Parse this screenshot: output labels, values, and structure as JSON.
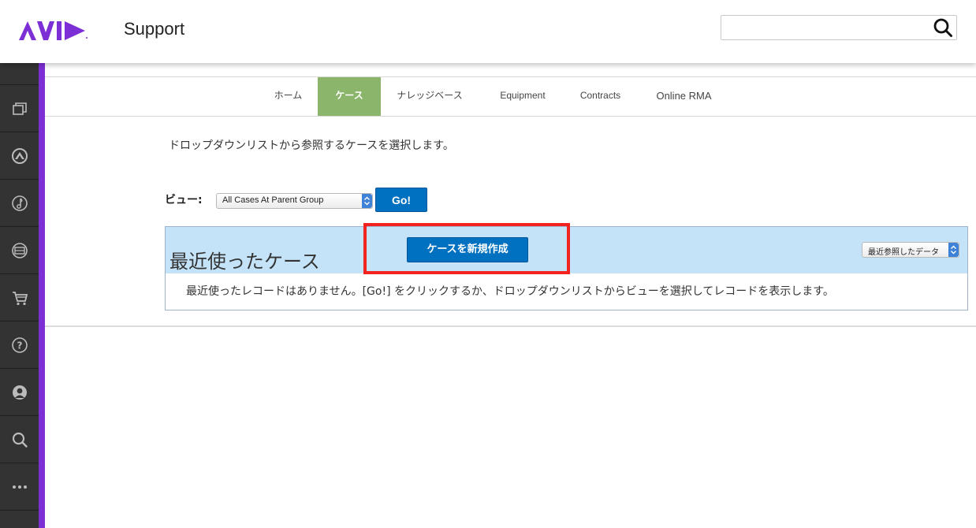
{
  "header": {
    "brand_title": "Support",
    "search": {
      "value": "",
      "placeholder": ""
    }
  },
  "sidebar": {
    "items": [
      {
        "icon": "windows-icon"
      },
      {
        "icon": "avid-link-icon"
      },
      {
        "icon": "music-note-icon"
      },
      {
        "icon": "film-reel-icon"
      },
      {
        "icon": "cart-icon"
      },
      {
        "icon": "help-icon"
      },
      {
        "icon": "user-icon"
      },
      {
        "icon": "search-icon"
      },
      {
        "icon": "more-icon"
      }
    ],
    "accent_color": "#7d2fd6"
  },
  "tabs": [
    {
      "label": "ホーム",
      "active": false
    },
    {
      "label": "ケース",
      "active": true
    },
    {
      "label": "ナレッジベース",
      "active": false
    },
    {
      "label": "Equipment",
      "active": false
    },
    {
      "label": "Contracts",
      "active": false
    },
    {
      "label": "Online RMA",
      "active": false
    }
  ],
  "main": {
    "instruction": "ドロップダウンリストから参照するケースを選択します。",
    "view": {
      "label": "ビュー:",
      "selected": "All Cases At Parent Group",
      "go_label": "Go!"
    },
    "recent": {
      "title": "最近使ったケース",
      "new_case_label": "ケースを新規作成",
      "sort_selected": "最近参照したデータ",
      "empty_message": "最近使ったレコードはありません。[Go!] をクリックするか、ドロップダウンリストからビューを選択してレコードを表示します。"
    }
  },
  "colors": {
    "primary_button": "#0070c0",
    "active_tab": "#8ab56a",
    "panel_header": "#c4e3f8",
    "highlight": "#f2231f"
  }
}
